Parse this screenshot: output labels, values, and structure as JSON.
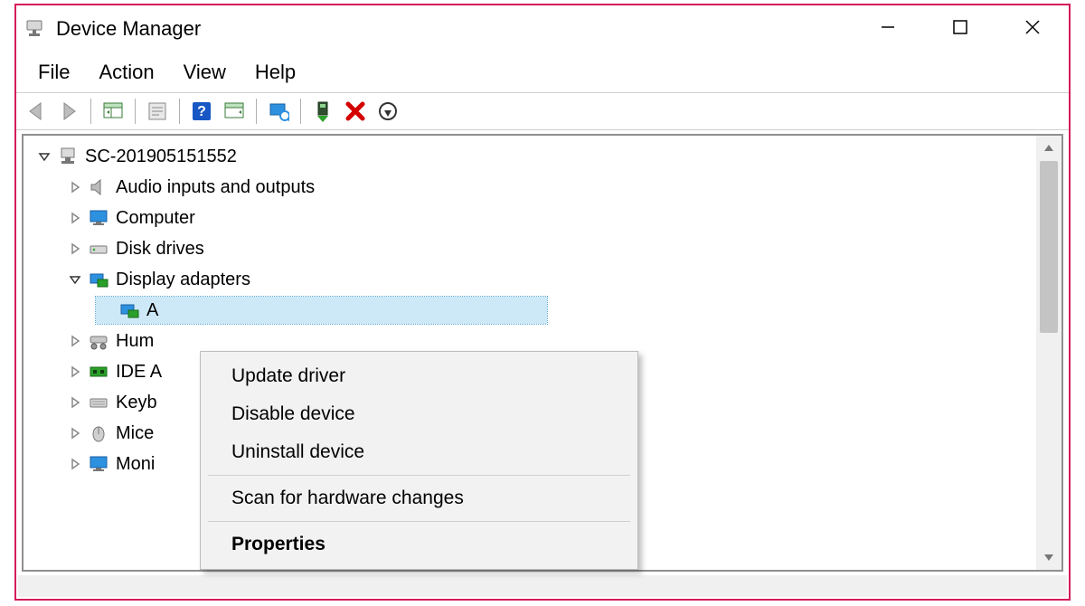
{
  "window": {
    "title": "Device Manager"
  },
  "menu": {
    "file": "File",
    "action": "Action",
    "view": "View",
    "help": "Help"
  },
  "tree": {
    "root": "SC-201905151552",
    "nodes": {
      "audio": "Audio inputs and outputs",
      "computer": "Computer",
      "disk": "Disk drives",
      "display": "Display adapters",
      "display_child": "A",
      "hid": "Hum",
      "ide": "IDE A",
      "keyb": "Keyb",
      "mice": "Mice",
      "moni": "Moni"
    }
  },
  "context_menu": {
    "update": "Update driver",
    "disable": "Disable device",
    "uninstall": "Uninstall device",
    "scan": "Scan for hardware changes",
    "properties": "Properties"
  }
}
